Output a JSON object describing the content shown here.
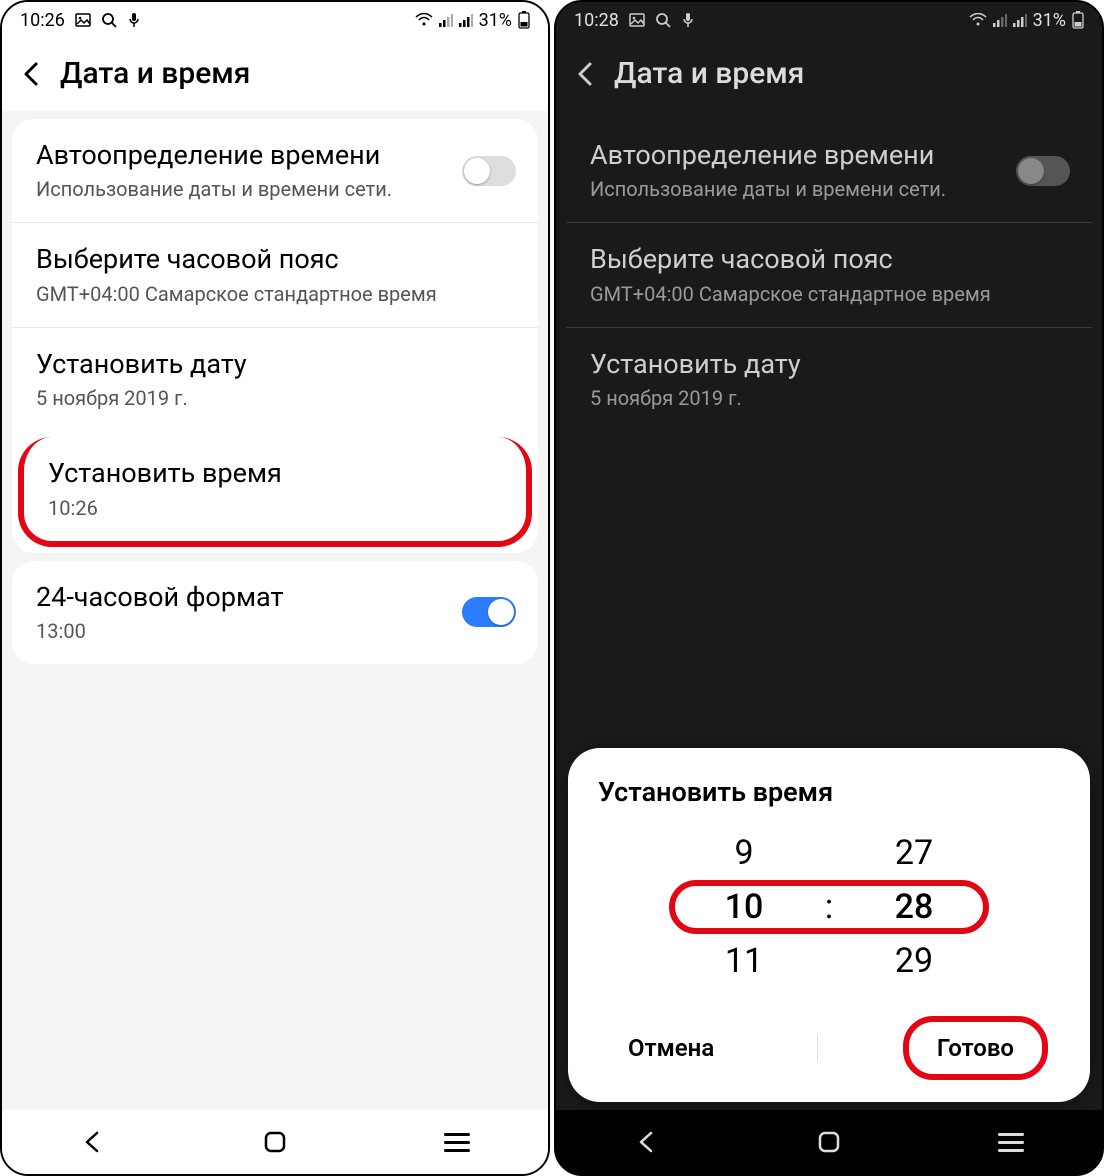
{
  "left": {
    "status": {
      "time": "10:26",
      "battery": "31%"
    },
    "header": {
      "title": "Дата и время"
    },
    "autoTime": {
      "title": "Автоопределение времени",
      "sub": "Использование даты и времени сети."
    },
    "timezone": {
      "title": "Выберите часовой пояс",
      "sub": "GMT+04:00 Самарское стандартное время"
    },
    "setDate": {
      "title": "Установить дату",
      "sub": "5 ноября 2019 г."
    },
    "setTime": {
      "title": "Установить время",
      "sub": "10:26"
    },
    "format24": {
      "title": "24-часовой формат",
      "sub": "13:00"
    }
  },
  "right": {
    "status": {
      "time": "10:28",
      "battery": "31%"
    },
    "header": {
      "title": "Дата и время"
    },
    "autoTime": {
      "title": "Автоопределение времени",
      "sub": "Использование даты и времени сети."
    },
    "timezone": {
      "title": "Выберите часовой пояс",
      "sub": "GMT+04:00 Самарское стандартное время"
    },
    "setDate": {
      "title": "Установить дату",
      "sub": "5 ноября 2019 г."
    },
    "dialog": {
      "title": "Установить время",
      "hourPrev": "9",
      "hourSel": "10",
      "hourNext": "11",
      "minPrev": "27",
      "minSel": "28",
      "minNext": "29",
      "colon": ":",
      "cancel": "Отмена",
      "done": "Готово"
    }
  }
}
